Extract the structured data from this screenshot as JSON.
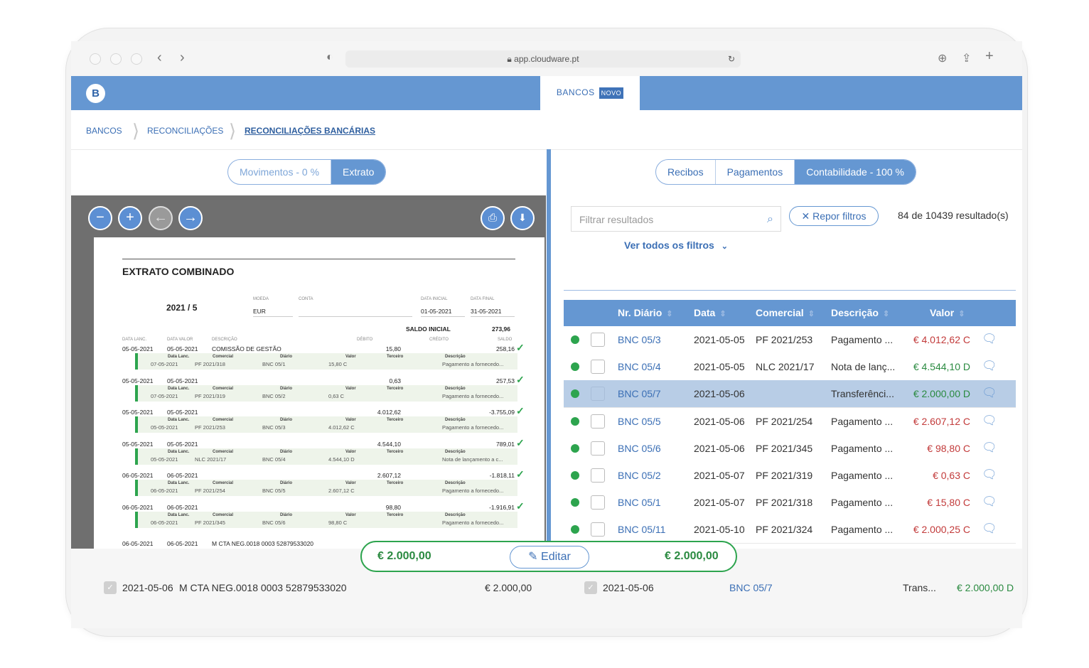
{
  "browser": {
    "url": "app.cloudware.pt"
  },
  "app": {
    "logo": "B",
    "tab_label": "BANCOS",
    "tab_badge": "NOVO"
  },
  "breadcrumb": [
    "BANCOS",
    "RECONCILIAÇÕES",
    "RECONCILIAÇÕES BANCÁRIAS"
  ],
  "left": {
    "toggle": [
      {
        "label": "Movimentos - 0 %",
        "active": false
      },
      {
        "label": "Extrato",
        "active": true
      }
    ],
    "document": {
      "title": "EXTRATO COMBINADO",
      "period": "2021 / 5",
      "header_labels": {
        "moeda": "MOEDA",
        "conta": "CONTA",
        "data_inicial": "DATA INICIAL",
        "data_final": "DATA FINAL"
      },
      "moeda": "EUR",
      "data_inicial": "01-05-2021",
      "data_final": "31-05-2021",
      "saldo_label": "SALDO INICIAL",
      "saldo_value": "273,96",
      "columns": [
        "DATA LANC.",
        "DATA VALOR",
        "DESCRIÇÃO",
        "DÉBITO",
        "CRÉDITO",
        "SALDO"
      ],
      "sub_labels": {
        "data": "Data Lanc.",
        "comercial": "Comercial",
        "diario": "Diário",
        "valor": "Valor",
        "terceiro": "Terceiro",
        "descricao": "Descrição"
      },
      "entries": [
        {
          "data_lanc": "05-05-2021",
          "data_valor": "05-05-2021",
          "descricao": "COMISSÃO DE GESTÃO",
          "debito": "15,80",
          "saldo": "258,16",
          "sub": {
            "data": "07-05-2021",
            "comercial": "PF 2021/318",
            "diario": "BNC 05/1",
            "valor": "15,80 C",
            "descricao": "Pagamento a fornecedo..."
          }
        },
        {
          "data_lanc": "05-05-2021",
          "data_valor": "05-05-2021",
          "descricao": "",
          "debito": "0,63",
          "saldo": "257,53",
          "sub": {
            "data": "07-05-2021",
            "comercial": "PF 2021/319",
            "diario": "BNC 05/2",
            "valor": "0,63 C",
            "descricao": "Pagamento a fornecedo..."
          }
        },
        {
          "data_lanc": "05-05-2021",
          "data_valor": "05-05-2021",
          "descricao": "",
          "debito": "4.012,62",
          "saldo": "-3.755,09",
          "sub": {
            "data": "05-05-2021",
            "comercial": "PF 2021/253",
            "diario": "BNC 05/3",
            "valor": "4.012,62 C",
            "descricao": "Pagamento a fornecedo..."
          }
        },
        {
          "data_lanc": "05-05-2021",
          "data_valor": "05-05-2021",
          "descricao": "",
          "debito": "4.544,10",
          "saldo": "789,01",
          "sub": {
            "data": "05-05-2021",
            "comercial": "NLC 2021/17",
            "diario": "BNC 05/4",
            "valor": "4.544,10 D",
            "descricao": "Nota de lançamento a c..."
          }
        },
        {
          "data_lanc": "06-05-2021",
          "data_valor": "06-05-2021",
          "descricao": "",
          "debito": "2.607,12",
          "saldo": "-1.818,11",
          "sub": {
            "data": "06-05-2021",
            "comercial": "PF 2021/254",
            "diario": "BNC 05/5",
            "valor": "2.607,12 C",
            "descricao": "Pagamento a fornecedo..."
          }
        },
        {
          "data_lanc": "06-05-2021",
          "data_valor": "06-05-2021",
          "descricao": "",
          "debito": "98,80",
          "saldo": "-1.916,91",
          "sub": {
            "data": "06-05-2021",
            "comercial": "PF 2021/345",
            "diario": "BNC 05/6",
            "valor": "98,80 C",
            "descricao": "Pagamento a fornecedo..."
          }
        }
      ],
      "last_line": {
        "data_lanc": "06-05-2021",
        "data_valor": "06-05-2021",
        "descricao": "M CTA NEG.0018 0003 52879533020"
      }
    }
  },
  "right": {
    "toggle": [
      {
        "label": "Recibos",
        "active": false
      },
      {
        "label": "Pagamentos",
        "active": false
      },
      {
        "label": "Contabilidade - 100 %",
        "active": true
      }
    ],
    "filter_placeholder": "Filtrar resultados",
    "reset_label": "Repor filtros",
    "results": "84 de 10439 resultado(s)",
    "all_filters": "Ver todos os filtros",
    "columns": [
      "Nr. Diário",
      "Data",
      "Comercial",
      "Descrição",
      "Valor"
    ],
    "rows": [
      {
        "nr": "BNC 05/3",
        "data": "2021-05-05",
        "comercial": "PF 2021/253",
        "descricao": "Pagamento ...",
        "valor": "€ 4.012,62 C",
        "selected": false
      },
      {
        "nr": "BNC 05/4",
        "data": "2021-05-05",
        "comercial": "NLC 2021/17",
        "descricao": "Nota de lanç...",
        "valor": "€ 4.544,10 D",
        "selected": false
      },
      {
        "nr": "BNC 05/7",
        "data": "2021-05-06",
        "comercial": "",
        "descricao": "Transferênci...",
        "valor": "€ 2.000,00 D",
        "selected": true
      },
      {
        "nr": "BNC 05/5",
        "data": "2021-05-06",
        "comercial": "PF 2021/254",
        "descricao": "Pagamento ...",
        "valor": "€ 2.607,12 C",
        "selected": false
      },
      {
        "nr": "BNC 05/6",
        "data": "2021-05-06",
        "comercial": "PF 2021/345",
        "descricao": "Pagamento ...",
        "valor": "€ 98,80 C",
        "selected": false
      },
      {
        "nr": "BNC 05/2",
        "data": "2021-05-07",
        "comercial": "PF 2021/319",
        "descricao": "Pagamento ...",
        "valor": "€ 0,63 C",
        "selected": false
      },
      {
        "nr": "BNC 05/1",
        "data": "2021-05-07",
        "comercial": "PF 2021/318",
        "descricao": "Pagamento ...",
        "valor": "€ 15,80 C",
        "selected": false
      },
      {
        "nr": "BNC 05/11",
        "data": "2021-05-10",
        "comercial": "PF 2021/324",
        "descricao": "Pagamento ...",
        "valor": "€ 2.000,25 C",
        "selected": false
      }
    ]
  },
  "bottom": {
    "left": {
      "date": "2021-05-06",
      "description": "M CTA NEG.0018 0003 52879533020",
      "amount": "€ 2.000,00"
    },
    "right": {
      "date": "2021-05-06",
      "nr": "BNC 05/7",
      "description": "Trans...",
      "amount": "€ 2.000,00 D"
    },
    "floater": {
      "left_amount": "€ 2.000,00",
      "edit_label": "Editar",
      "right_amount": "€ 2.000,00"
    }
  },
  "colors": {
    "primary": "#6597d2",
    "success": "#2da44e",
    "debit": "#c23a3a"
  }
}
